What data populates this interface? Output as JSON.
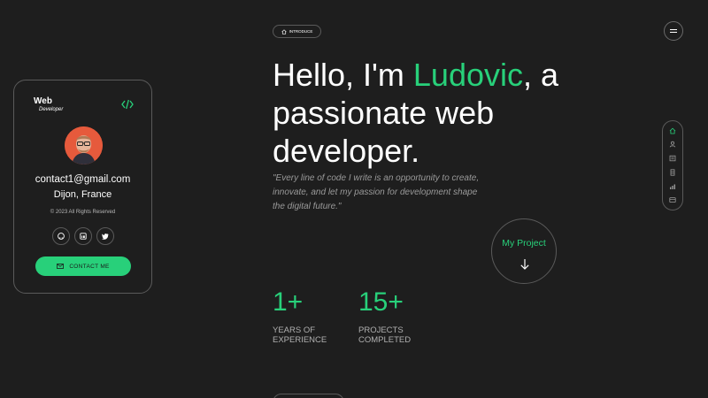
{
  "card": {
    "brand_title": "Web",
    "brand_subtitle": "Developer",
    "email": "contact1@gmail.com",
    "location": "Dijon, France",
    "copyright": "© 2023 All Rights Reserved",
    "socials": [
      "github-icon",
      "linkedin-icon",
      "twitter-icon"
    ],
    "contact_label": "CONTACT ME"
  },
  "intro_badge": {
    "label": "INTRODUCE"
  },
  "hero": {
    "line_prefix": "Hello, I'm ",
    "name": "Ludovic",
    "line_suffix": ", a",
    "line2": "passionate web",
    "line3": "developer."
  },
  "quote": "\"Every line of code I write is an opportunity to create, innovate, and let my passion for development shape the digital future.\"",
  "project": {
    "label": "My Project"
  },
  "stats": [
    {
      "value": "1+",
      "label": "YEARS OF EXPERIENCE"
    },
    {
      "value": "15+",
      "label": "PROJECTS COMPLETED"
    }
  ],
  "nav_rail": [
    "home-icon",
    "user-icon",
    "resume-icon",
    "services-icon",
    "skills-icon",
    "portfolio-icon"
  ],
  "colors": {
    "accent": "#28d07a",
    "background": "#1e1e1e",
    "border": "#5a5a5a",
    "avatar_bg": "#e65a3c"
  }
}
